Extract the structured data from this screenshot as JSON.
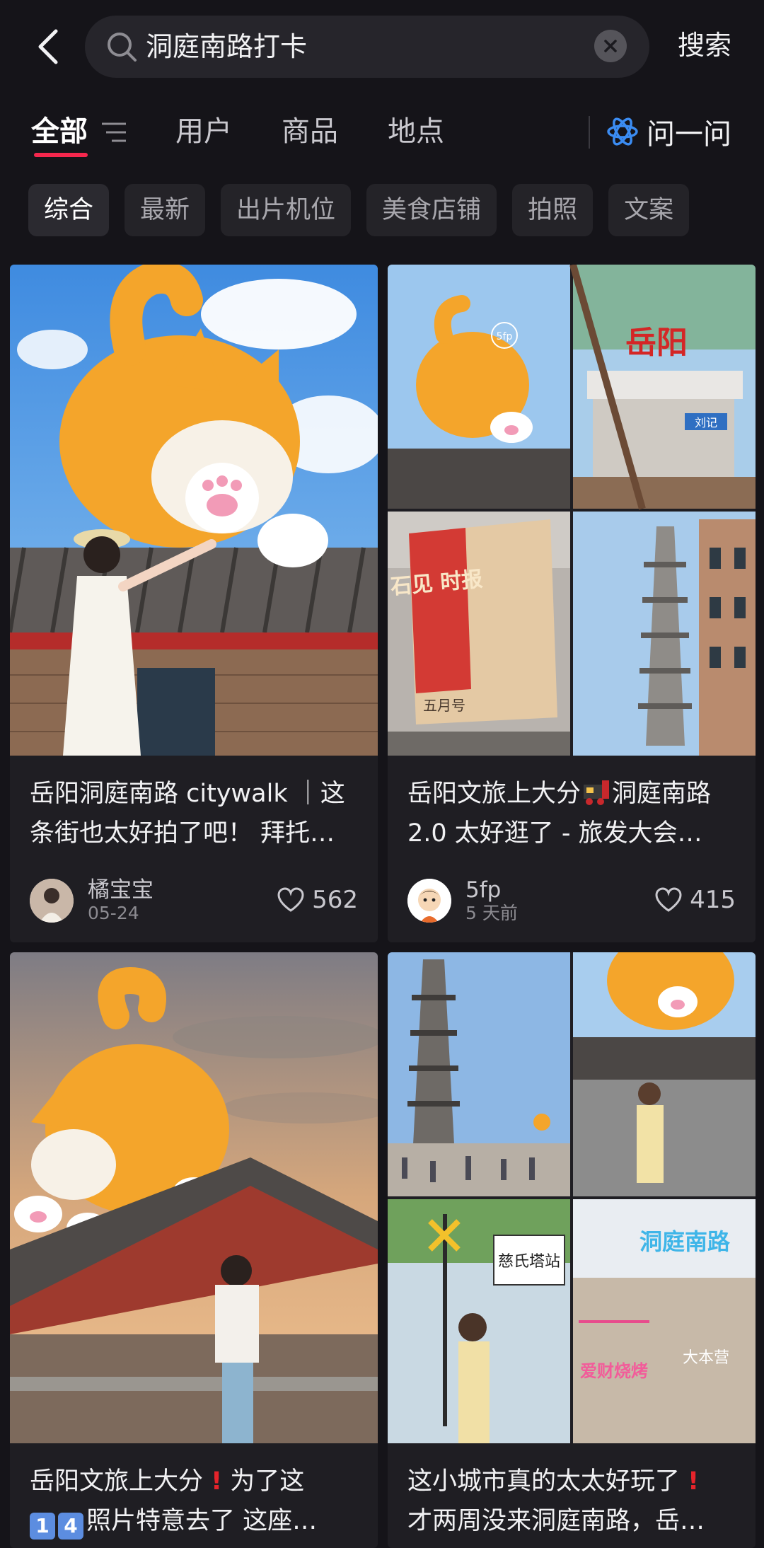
{
  "search": {
    "query": "洞庭南路打卡",
    "submit_label": "搜索"
  },
  "tabs": [
    {
      "label": "全部",
      "active": true
    },
    {
      "label": "用户",
      "active": false
    },
    {
      "label": "商品",
      "active": false
    },
    {
      "label": "地点",
      "active": false
    }
  ],
  "ask": {
    "label": "问一问"
  },
  "chips": [
    "综合",
    "最新",
    "出片机位",
    "美食店铺",
    "拍照",
    "文案"
  ],
  "colors": {
    "accent_underline": "#F5274D",
    "background": "#151419",
    "card": "#1F1E23",
    "ask_icon": "#3B8CF2"
  },
  "cards": [
    {
      "title": "岳阳洞庭南路 citywalk ｜这条街也太好拍了吧！ 拜托…",
      "author": "橘宝宝",
      "date": "05-24",
      "likes": "562"
    },
    {
      "title_part1": "岳阳文旅上大分",
      "title_part2": "洞庭南路2.0 太好逛了 - 旅发大会…",
      "author": "5fp",
      "date": "5 天前",
      "likes": "415",
      "collage_text": {
        "sign1": "岳阳",
        "sign2": "刘记",
        "poster": "石见 时报",
        "poster_month": "五月号",
        "badge": "5fp"
      }
    },
    {
      "title_part1": "岳阳文旅上大分",
      "title_part2": "为了这",
      "title_part3": "照片特意去了 这座…",
      "digit1": "1",
      "digit2": "4"
    },
    {
      "title_part1": "这小城市真的太太好玩了",
      "title_part2": "才两周没来洞庭南路，岳…",
      "collage_text": {
        "station": "慈氏塔站",
        "neon1": "洞庭南路",
        "neon2": "爱财烧烤",
        "neon3": "大本营"
      }
    }
  ]
}
